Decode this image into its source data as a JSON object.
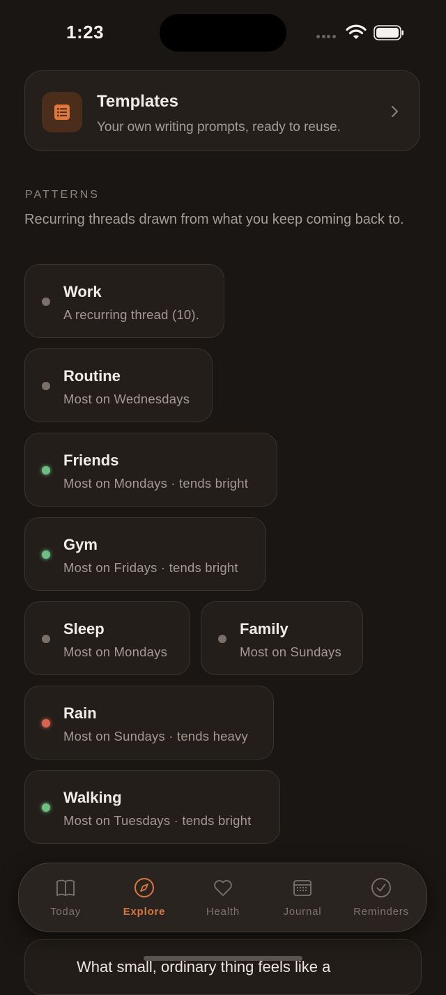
{
  "status_bar": {
    "time": "1:23"
  },
  "templates_card": {
    "title": "Templates",
    "subtitle": "Your own writing prompts, ready to reuse.",
    "icon": "list-icon"
  },
  "patterns": {
    "label": "PATTERNS",
    "description": "Recurring threads drawn from what you keep coming back to.",
    "items": [
      {
        "name": "Work",
        "detail": "A recurring thread (10).",
        "dot_color": "#7a7067"
      },
      {
        "name": "Routine",
        "detail": "Most on Wednesdays",
        "dot_color": "#7a7067"
      },
      {
        "name": "Friends",
        "detail": "Most on Mondays · tends bright",
        "dot_color": "#6fbf85"
      },
      {
        "name": "Gym",
        "detail": "Most on Fridays · tends bright",
        "dot_color": "#6fbf85"
      },
      {
        "name": "Sleep",
        "detail": "Most on Mondays",
        "dot_color": "#7a7067"
      },
      {
        "name": "Family",
        "detail": "Most on Sundays",
        "dot_color": "#7a7067"
      },
      {
        "name": "Rain",
        "detail": "Most on Sundays · tends heavy",
        "dot_color": "#d8664e"
      },
      {
        "name": "Walking",
        "detail": "Most on Tuesdays · tends bright",
        "dot_color": "#6fbf85"
      }
    ]
  },
  "prompt_card": {
    "text": "What small, ordinary thing feels like a"
  },
  "tab_bar": {
    "tabs": [
      {
        "label": "Today",
        "icon": "book-icon",
        "active": false
      },
      {
        "label": "Explore",
        "icon": "compass-icon",
        "active": true
      },
      {
        "label": "Health",
        "icon": "heart-icon",
        "active": false
      },
      {
        "label": "Journal",
        "icon": "calendar-icon",
        "active": false
      },
      {
        "label": "Reminders",
        "icon": "checkmark-circle-icon",
        "active": false
      }
    ]
  },
  "colors": {
    "accent": "#d9773f",
    "background": "#1a1613",
    "positive": "#6fbf85",
    "negative": "#d8664e",
    "neutral": "#7a7067"
  }
}
